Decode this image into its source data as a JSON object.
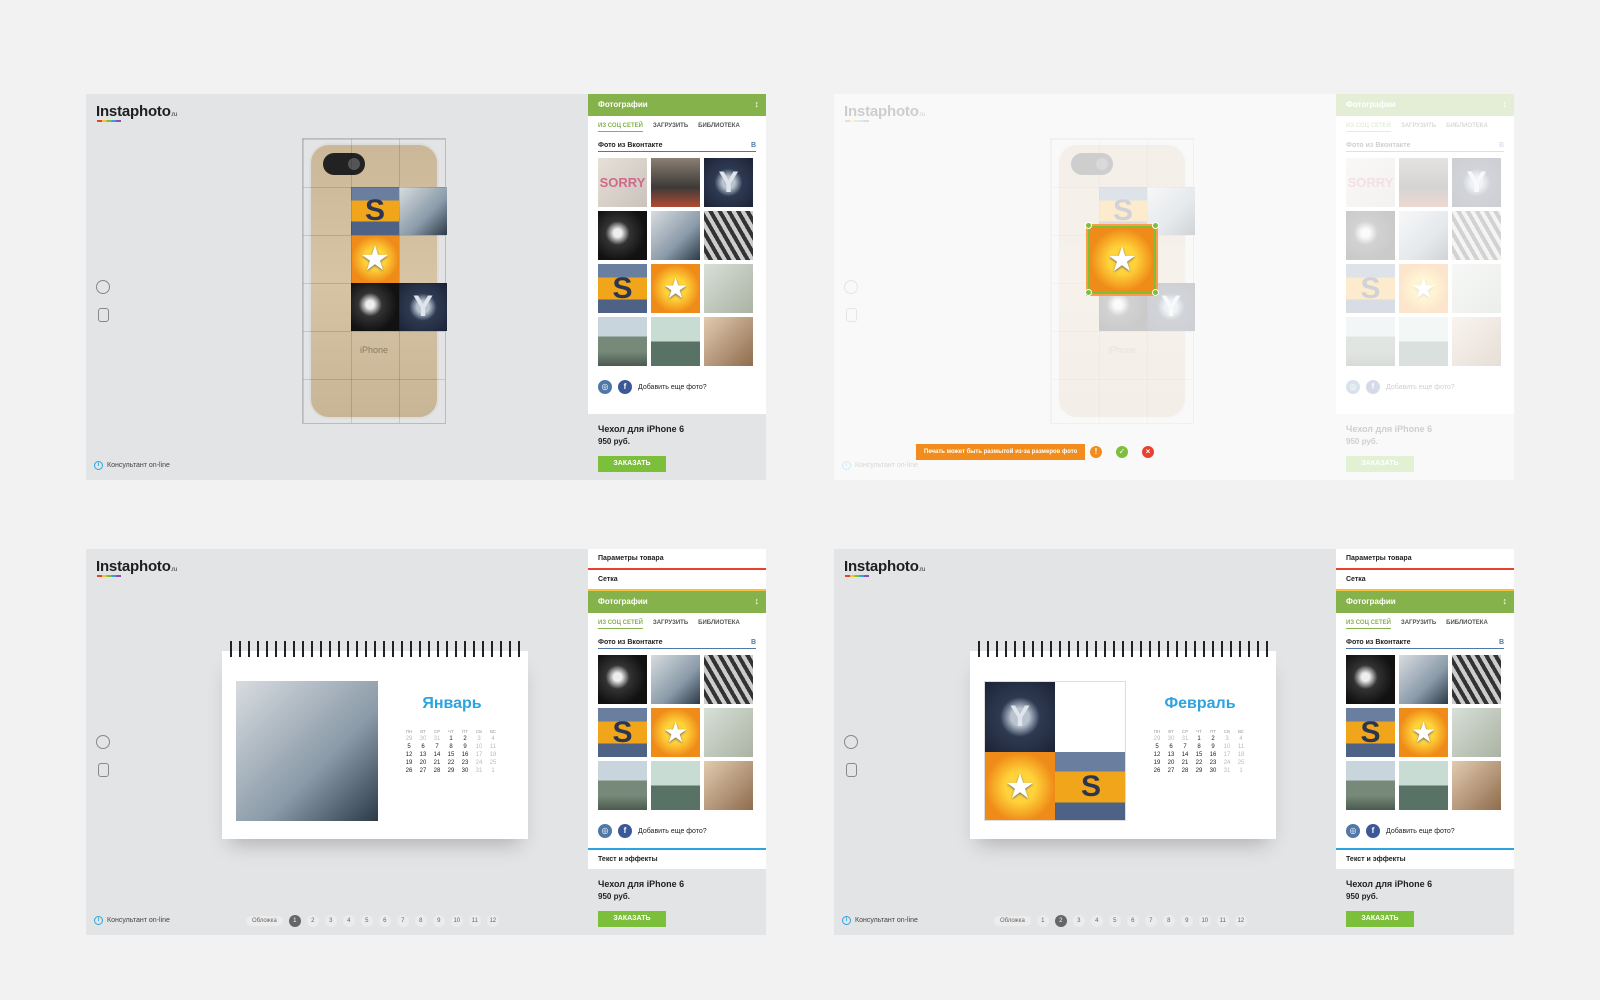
{
  "brand": {
    "name_left": "Insta",
    "name_right": "photo",
    "suffix": ".ru"
  },
  "consultant": "Консультант on-line",
  "panel": {
    "photos_title": "Фотографии",
    "tabs": [
      "ИЗ СОЦ СЕТЕЙ",
      "ЗАГРУЗИТЬ",
      "БИБЛИОТЕКА"
    ],
    "vk_label": "Фото из Вконтакте",
    "vk_badge": "В",
    "add_more": "Добавить еще фото?",
    "sections": {
      "params": "Параметры товара",
      "grid": "Сетка",
      "text_effects": "Текст и эффекты"
    }
  },
  "product": {
    "title": "Чехол для iPhone 6",
    "price": "950 руб.",
    "order_button": "ЗАКАЗАТЬ"
  },
  "phone_label": "iPhone",
  "warning": "Печать может быть размытой из-за размеров фото",
  "calendar": {
    "months": [
      "Январь",
      "Февраль"
    ],
    "weekdays": [
      "ПН",
      "ВТ",
      "СР",
      "ЧТ",
      "ПТ",
      "СБ",
      "ВС"
    ],
    "cover_label": "Обложка",
    "pages": [
      "1",
      "2",
      "3",
      "4",
      "5",
      "6",
      "7",
      "8",
      "9",
      "10",
      "11",
      "12"
    ]
  },
  "colors": {
    "green": "#86b24c",
    "button_green": "#7cbf3a",
    "blue": "#2da3e0",
    "orange": "#f28c1c",
    "red": "#e8412e",
    "yellow": "#f6c23e"
  }
}
